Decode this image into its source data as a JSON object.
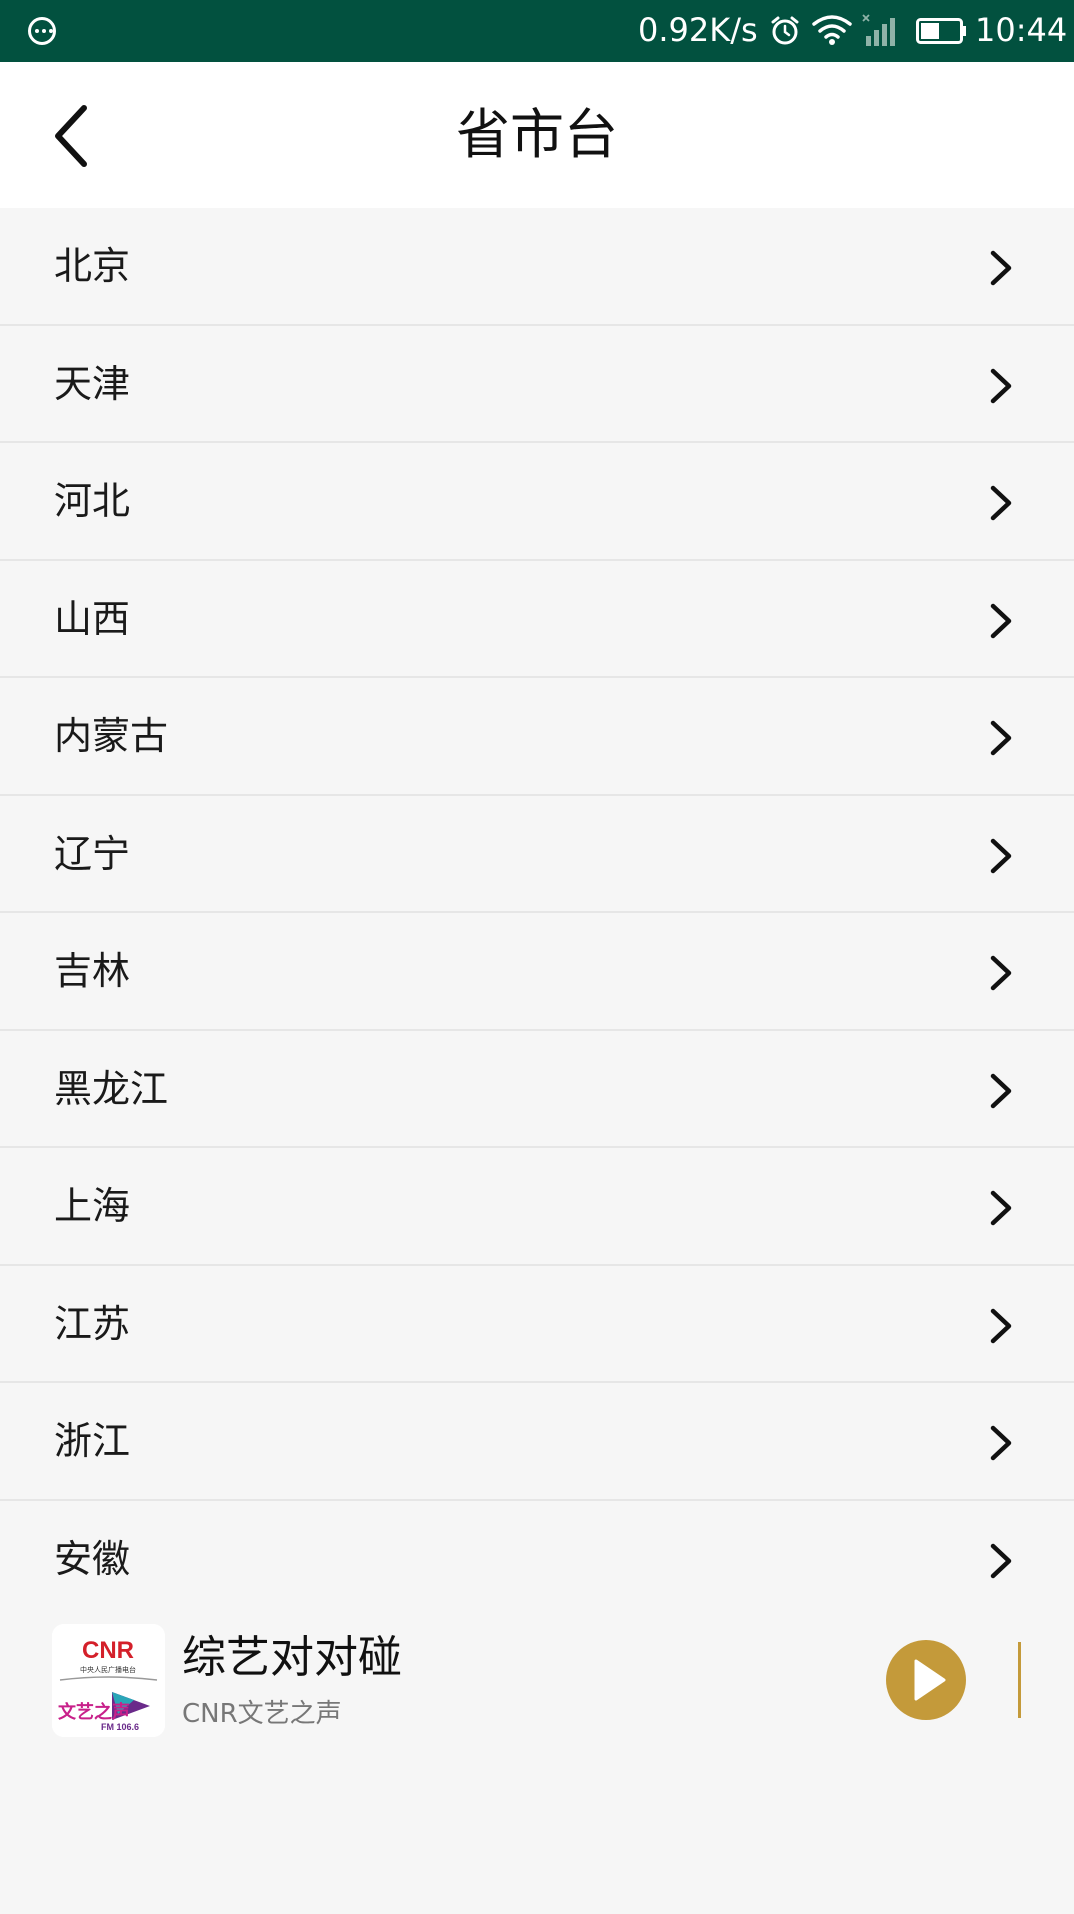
{
  "status_bar": {
    "net_speed": "0.92K/s",
    "time": "10:44",
    "icons": [
      "menu-dots-icon",
      "alarm-icon",
      "wifi-icon",
      "signal-icon",
      "battery-icon"
    ]
  },
  "header": {
    "title": "省市台",
    "back_icon": "chevron-left-icon"
  },
  "provinces": [
    {
      "label": "北京"
    },
    {
      "label": "天津"
    },
    {
      "label": "河北"
    },
    {
      "label": "山西"
    },
    {
      "label": "内蒙古"
    },
    {
      "label": "辽宁"
    },
    {
      "label": "吉林"
    },
    {
      "label": "黑龙江"
    },
    {
      "label": "上海"
    },
    {
      "label": "江苏"
    },
    {
      "label": "浙江"
    },
    {
      "label": "安徽"
    }
  ],
  "player": {
    "title": "综艺对对碰",
    "subtitle": "CNR文艺之声",
    "logo": {
      "top_text": "CNR",
      "middle_text": "中央人民广播电台",
      "bottom_text": "文艺之声",
      "frequency": "FM 106.6"
    },
    "accent_color": "#c49a3a"
  },
  "colors": {
    "status_bar": "#02513f",
    "background": "#f6f6f6",
    "header": "#ffffff"
  }
}
